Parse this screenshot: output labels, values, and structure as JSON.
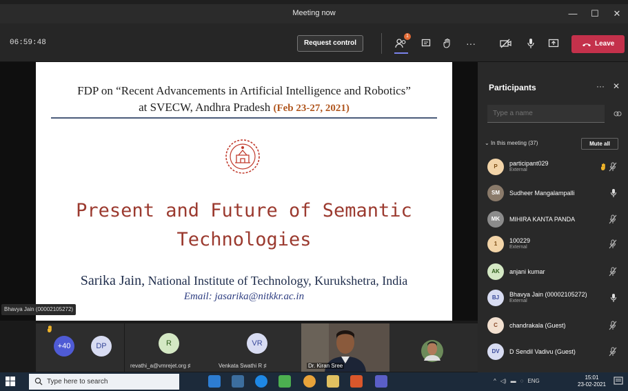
{
  "window": {
    "title": "Meeting now",
    "minimize": "—",
    "maximize": "☐",
    "close": "✕"
  },
  "toolbar": {
    "timer": "06:59:48",
    "request_control": "Request control",
    "participants_badge": "1",
    "more": "···",
    "leave": "Leave"
  },
  "slide": {
    "heading_line1": "FDP on “Recent Advancements in Artificial Intelligence and Robotics”",
    "heading_line2": "at SVECW, Andhra Pradesh",
    "heading_date": "(Feb 23-27, 2021)",
    "title_line1": "Present and Future of Semantic",
    "title_line2": "Technologies",
    "author_name": "Sarika Jain,",
    "author_affiliation": "National Institute of Technology, Kurukshetra, India",
    "email": "Email: jasarika@nitkkr.ac.in"
  },
  "presenter_tag": "Bhavya Jain (00002105272)",
  "strip": {
    "overflow_count": "+40",
    "tiles": [
      {
        "initials": "DP",
        "label": ""
      },
      {
        "initials": "R",
        "label": "revathi_a@vmrejet.org"
      },
      {
        "initials": "VR",
        "label": "Venkata Swathi R"
      },
      {
        "initials": "",
        "label": "Dr. Kiran Sree"
      }
    ]
  },
  "participants": {
    "title": "Participants",
    "more": "···",
    "close": "✕",
    "search_placeholder": "Type a name",
    "in_meeting": "In this meeting (37)",
    "mute_all": "Mute all",
    "list": [
      {
        "initials": "P",
        "name": "participant029",
        "sub": "External",
        "color": "#f2d4a8",
        "text": "#7a4b12"
      },
      {
        "initials": "SM",
        "name": "Sudheer Mangalampalli",
        "sub": "",
        "color": "#8a7a6a",
        "text": "#fff"
      },
      {
        "initials": "MK",
        "name": "MIHIRA KANTA PANDA",
        "sub": "",
        "color": "#8c8c8c",
        "text": "#fff"
      },
      {
        "initials": "1",
        "name": "100229",
        "sub": "External",
        "color": "#f2d4a8",
        "text": "#7a4b12"
      },
      {
        "initials": "AK",
        "name": "anjani kumar",
        "sub": "",
        "color": "#d4e8c4",
        "text": "#2e5d1a"
      },
      {
        "initials": "BJ",
        "name": "Bhavya Jain (00002105272)",
        "sub": "External",
        "color": "#d8dcf2",
        "text": "#3a4a9a"
      },
      {
        "initials": "C",
        "name": "chandrakala (Guest)",
        "sub": "",
        "color": "#f2e0d0",
        "text": "#8a4a2a"
      },
      {
        "initials": "DV",
        "name": "D Sendil Vadivu (Guest)",
        "sub": "",
        "color": "#d8dcf2",
        "text": "#3a4a9a"
      }
    ]
  },
  "taskbar": {
    "search_placeholder": "Type here to search",
    "language": "ENG",
    "time": "15:01",
    "date": "23-02-2021"
  }
}
